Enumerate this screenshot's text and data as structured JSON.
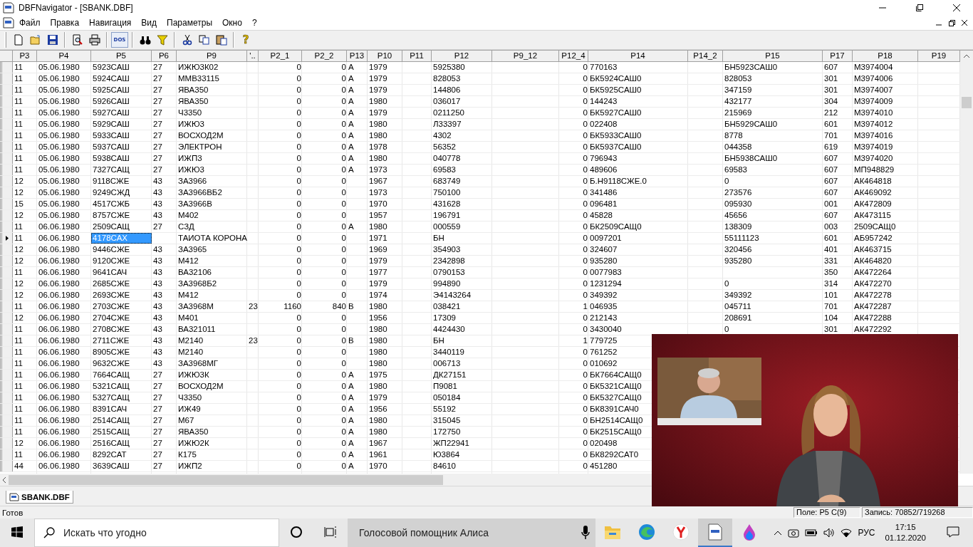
{
  "window": {
    "title": "DBFNavigator - [SBANK.DBF]"
  },
  "menu": [
    {
      "label": "Файл"
    },
    {
      "label": "Правка"
    },
    {
      "label": "Навигация"
    },
    {
      "label": "Вид"
    },
    {
      "label": "Параметры"
    },
    {
      "label": "Окно"
    },
    {
      "label": "?"
    }
  ],
  "toolbar": [
    {
      "kind": "new"
    },
    {
      "kind": "open"
    },
    {
      "kind": "save"
    },
    {
      "kind": "separator"
    },
    {
      "kind": "preview"
    },
    {
      "kind": "print"
    },
    {
      "kind": "separator"
    },
    {
      "kind": "dos",
      "label": "DOS"
    },
    {
      "kind": "separator"
    },
    {
      "kind": "find"
    },
    {
      "kind": "filter"
    },
    {
      "kind": "separator"
    },
    {
      "kind": "cut"
    },
    {
      "kind": "copy"
    },
    {
      "kind": "paste"
    },
    {
      "kind": "separator"
    },
    {
      "kind": "help",
      "label": "?"
    }
  ],
  "table": {
    "columns": [
      {
        "label": "P3",
        "kind": "text"
      },
      {
        "label": "P4",
        "kind": "text"
      },
      {
        "label": "P5",
        "kind": "text"
      },
      {
        "label": "P6",
        "kind": "text"
      },
      {
        "label": "P9",
        "kind": "text"
      },
      {
        "label": "'..",
        "kind": "text"
      },
      {
        "label": "P2_1",
        "kind": "number"
      },
      {
        "label": "P2_2",
        "kind": "number"
      },
      {
        "label": "P13",
        "kind": "text"
      },
      {
        "label": "P10",
        "kind": "text"
      },
      {
        "label": "P11"
      },
      {
        "label": "P12",
        "kind": "text"
      },
      {
        "label": "P9_12"
      },
      {
        "label": "P12_4",
        "kind": "number"
      },
      {
        "label": "P14",
        "kind": "text"
      },
      {
        "label": "P14_2"
      },
      {
        "label": "P15",
        "kind": "text"
      },
      {
        "label": "P17",
        "kind": "text"
      },
      {
        "label": "P18",
        "kind": "text"
      },
      {
        "label": "P19"
      }
    ],
    "rows": [
      {
        "selected": false,
        "cells": [
          "11",
          "05.06.1980",
          "5923САШ",
          "27",
          "ИЖЮ3К02",
          null,
          "0",
          "0",
          "А",
          "1979",
          null,
          "5925380",
          null,
          "0",
          "770163",
          null,
          "БН5923САШ0",
          "607",
          "М3974004",
          null
        ]
      },
      {
        "selected": false,
        "cells": [
          "11",
          "05.06.1980",
          "5924САШ",
          "27",
          "ММВ33115",
          null,
          "0",
          "0",
          "А",
          "1979",
          null,
          "828053",
          null,
          "0",
          "БК5924САШ0",
          null,
          "828053",
          "301",
          "М3974006",
          null
        ]
      },
      {
        "selected": false,
        "cells": [
          "11",
          "05.06.1980",
          "5925САШ",
          "27",
          "ЯВА350",
          null,
          "0",
          "0",
          "А",
          "1979",
          null,
          "144806",
          null,
          "0",
          "БК5925САШ0",
          null,
          "347159",
          "301",
          "М3974007",
          null
        ]
      },
      {
        "selected": false,
        "cells": [
          "11",
          "05.06.1980",
          "5926САШ",
          "27",
          "ЯВА350",
          null,
          "0",
          "0",
          "А",
          "1980",
          null,
          "036017",
          null,
          "0",
          "144243",
          null,
          "432177",
          "304",
          "М3974009",
          null
        ]
      },
      {
        "selected": false,
        "cells": [
          "11",
          "05.06.1980",
          "5927САШ",
          "27",
          "Ч3350",
          null,
          "0",
          "0",
          "А",
          "1979",
          null,
          "0211250",
          null,
          "0",
          "БК5927САШ0",
          null,
          "215969",
          "212",
          "М3974010",
          null
        ]
      },
      {
        "selected": false,
        "cells": [
          "11",
          "05.06.1980",
          "5929САШ",
          "27",
          "ИЖЮ3",
          null,
          "0",
          "0",
          "А",
          "1980",
          null,
          "Л33397",
          null,
          "0",
          "022408",
          null,
          "БН5929САШ0",
          "601",
          "М3974012",
          null
        ]
      },
      {
        "selected": false,
        "cells": [
          "11",
          "05.06.1980",
          "5933САШ",
          "27",
          "ВОСХОД2М",
          null,
          "0",
          "0",
          "А",
          "1980",
          null,
          "4302",
          null,
          "0",
          "БК5933САШ0",
          null,
          "8778",
          "701",
          "М3974016",
          null
        ]
      },
      {
        "selected": false,
        "cells": [
          "11",
          "05.06.1980",
          "5937САШ",
          "27",
          "ЭЛЕКТРОН",
          null,
          "0",
          "0",
          "А",
          "1978",
          null,
          "56352",
          null,
          "0",
          "БК5937САШ0",
          null,
          "044358",
          "619",
          "М3974019",
          null
        ]
      },
      {
        "selected": false,
        "cells": [
          "11",
          "05.06.1980",
          "5938САШ",
          "27",
          "ИЖП3",
          null,
          "0",
          "0",
          "А",
          "1980",
          null,
          "040778",
          null,
          "0",
          "796943",
          null,
          "БН5938САШ0",
          "607",
          "М3974020",
          null
        ]
      },
      {
        "selected": false,
        "cells": [
          "11",
          "05.06.1980",
          "7327САЩ",
          "27",
          "ИЖЮ3",
          null,
          "0",
          "0",
          "А",
          "1973",
          null,
          "69583",
          null,
          "0",
          "489606",
          null,
          "69583",
          "607",
          "МП948829",
          null
        ]
      },
      {
        "selected": false,
        "cells": [
          "12",
          "05.06.1980",
          "9118СЖЕ",
          "43",
          "ЗА3966",
          null,
          "0",
          "0",
          null,
          "1967",
          null,
          "683749",
          null,
          "0",
          "Б.Н9118СЖЕ.0",
          null,
          "0",
          "607",
          "АК464818",
          null
        ]
      },
      {
        "selected": false,
        "cells": [
          "12",
          "05.06.1980",
          "9249СЖД",
          "43",
          "ЗА3966ВБ2",
          null,
          "0",
          "0",
          null,
          "1973",
          null,
          "750100",
          null,
          "0",
          "341486",
          null,
          "273576",
          "607",
          "АК469092",
          null
        ]
      },
      {
        "selected": false,
        "cells": [
          "15",
          "05.06.1980",
          "4517СЖБ",
          "43",
          "ЗА3966В",
          null,
          "0",
          "0",
          null,
          "1970",
          null,
          "431628",
          null,
          "0",
          "096481",
          null,
          "095930",
          "001",
          "АК472809",
          null
        ]
      },
      {
        "selected": false,
        "cells": [
          "12",
          "05.06.1980",
          "8757СЖЕ",
          "43",
          "М402",
          null,
          "0",
          "0",
          null,
          "1957",
          null,
          "196791",
          null,
          "0",
          "45828",
          null,
          "45656",
          "607",
          "АК473115",
          null
        ]
      },
      {
        "selected": false,
        "cells": [
          "11",
          "06.06.1980",
          "2509САЩ",
          "27",
          "СЗД",
          null,
          "0",
          "0",
          "А",
          "1980",
          null,
          "000559",
          null,
          "0",
          "БК2509САЩ0",
          null,
          "138309",
          "003",
          "2509САЩ0",
          null
        ]
      },
      {
        "selected": true,
        "cells": [
          "11",
          "06.06.1980",
          {
            "text": "4178САХ",
            "selected": true
          },
          null,
          "ТАИОТА КОРОНА",
          null,
          "0",
          "0",
          null,
          "1971",
          null,
          "БН",
          null,
          "0",
          "0097201",
          null,
          "55111123",
          "601",
          "АБ957242",
          null
        ]
      },
      {
        "selected": false,
        "cells": [
          "12",
          "06.06.1980",
          "9446СЖЕ",
          "43",
          "ЗА3965",
          null,
          "0",
          "0",
          null,
          "1969",
          null,
          "354903",
          null,
          "0",
          "324607",
          null,
          "320456",
          "401",
          "АК463715",
          null
        ]
      },
      {
        "selected": false,
        "cells": [
          "12",
          "06.06.1980",
          "9120СЖЕ",
          "43",
          "М412",
          null,
          "0",
          "0",
          null,
          "1979",
          null,
          "2342898",
          null,
          "0",
          "935280",
          null,
          "935280",
          "331",
          "АК464820",
          null
        ]
      },
      {
        "selected": false,
        "cells": [
          "11",
          "06.06.1980",
          "9641САЧ",
          "43",
          "ВА32106",
          null,
          "0",
          "0",
          null,
          "1977",
          null,
          "0790153",
          null,
          "0",
          "0077983",
          null,
          null,
          "350",
          "АК472264",
          null
        ]
      },
      {
        "selected": false,
        "cells": [
          "12",
          "06.06.1980",
          "2685СЖЕ",
          "43",
          "ЗА3968Б2",
          null,
          "0",
          "0",
          null,
          "1979",
          null,
          "994890",
          null,
          "0",
          "1231294",
          null,
          "0",
          "314",
          "АК472270",
          null
        ]
      },
      {
        "selected": false,
        "cells": [
          "12",
          "06.06.1980",
          "2693СЖЕ",
          "43",
          "М412",
          null,
          "0",
          "0",
          null,
          "1974",
          null,
          "Э4143264",
          null,
          "0",
          "349392",
          null,
          "349392",
          "101",
          "АК472278",
          null
        ]
      },
      {
        "selected": false,
        "cells": [
          "11",
          "06.06.1980",
          "2703СЖЕ",
          "43",
          "ЗА3968М",
          "23",
          "1160",
          "840",
          "В",
          "1980",
          null,
          "038421",
          null,
          "1",
          "046935",
          null,
          "045711",
          "701",
          "АК472287",
          null
        ]
      },
      {
        "selected": false,
        "cells": [
          "12",
          "06.06.1980",
          "2704СЖЕ",
          "43",
          "М401",
          null,
          "0",
          "0",
          null,
          "1956",
          null,
          "17309",
          null,
          "0",
          "212143",
          null,
          "208691",
          "104",
          "АК472288",
          null
        ]
      },
      {
        "selected": false,
        "cells": [
          "11",
          "06.06.1980",
          "2708СЖЕ",
          "43",
          "ВА321011",
          null,
          "0",
          "0",
          null,
          "1980",
          null,
          "4424430",
          null,
          "0",
          "3430040",
          null,
          "0",
          "301",
          "АК472292",
          null
        ]
      },
      {
        "selected": false,
        "cells": [
          "11",
          "06.06.1980",
          "2711СЖЕ",
          "43",
          "М2140",
          "23",
          "0",
          "0",
          "В",
          "1980",
          null,
          "БН",
          null,
          "1",
          "779725",
          null,
          null,
          null,
          null,
          null
        ]
      },
      {
        "selected": false,
        "cells": [
          "11",
          "06.06.1980",
          "8905СЖЕ",
          "43",
          "М2140",
          null,
          "0",
          "0",
          null,
          "1980",
          null,
          "3440119",
          null,
          "0",
          "761252",
          null,
          null,
          null,
          null,
          null
        ]
      },
      {
        "selected": false,
        "cells": [
          "11",
          "06.06.1980",
          "9632СЖЕ",
          "43",
          "ЗА3968МГ",
          null,
          "0",
          "0",
          null,
          "1980",
          null,
          "006713",
          null,
          "0",
          "010692",
          null,
          null,
          null,
          null,
          null
        ]
      },
      {
        "selected": false,
        "cells": [
          "11",
          "06.06.1980",
          "7664САЩ",
          "27",
          "ИЖЮ3К",
          null,
          "0",
          "0",
          "А",
          "1975",
          null,
          "ДК27151",
          null,
          "0",
          "БК7664САЩ0",
          null,
          null,
          null,
          null,
          null
        ]
      },
      {
        "selected": false,
        "cells": [
          "11",
          "06.06.1980",
          "5321САЩ",
          "27",
          "ВОСХОД2М",
          null,
          "0",
          "0",
          "А",
          "1980",
          null,
          "П9081",
          null,
          "0",
          "БК5321САЩ0",
          null,
          null,
          null,
          null,
          null
        ]
      },
      {
        "selected": false,
        "cells": [
          "11",
          "06.06.1980",
          "5327САЩ",
          "27",
          "Ч3350",
          null,
          "0",
          "0",
          "А",
          "1979",
          null,
          "050184",
          null,
          "0",
          "БК5327САЩ0",
          null,
          null,
          null,
          null,
          null
        ]
      },
      {
        "selected": false,
        "cells": [
          "11",
          "06.06.1980",
          "8391САЧ",
          "27",
          "ИЖ49",
          null,
          "0",
          "0",
          "А",
          "1956",
          null,
          "55192",
          null,
          "0",
          "БК8391САЧ0",
          null,
          null,
          null,
          null,
          null
        ]
      },
      {
        "selected": false,
        "cells": [
          "11",
          "06.06.1980",
          "2514САЩ",
          "27",
          "М67",
          null,
          "0",
          "0",
          "А",
          "1980",
          null,
          "315045",
          null,
          "0",
          "БН2514САЩ0",
          null,
          null,
          null,
          null,
          null
        ]
      },
      {
        "selected": false,
        "cells": [
          "11",
          "06.06.1980",
          "2515САЩ",
          "27",
          "ЯВА350",
          null,
          "0",
          "0",
          "А",
          "1980",
          null,
          "172750",
          null,
          "0",
          "БК2515САЩ0",
          null,
          null,
          null,
          null,
          null
        ]
      },
      {
        "selected": false,
        "cells": [
          "12",
          "06.06.1980",
          "2516САЩ",
          "27",
          "ИЖЮ2К",
          null,
          "0",
          "0",
          "А",
          "1967",
          null,
          "ЖП22941",
          null,
          "0",
          "020498",
          null,
          null,
          null,
          null,
          null
        ]
      },
      {
        "selected": false,
        "cells": [
          "11",
          "06.06.1980",
          "8292САТ",
          "27",
          "К175",
          null,
          "0",
          "0",
          "А",
          "1961",
          null,
          "Ю3864",
          null,
          "0",
          "БК8292САТ0",
          null,
          null,
          null,
          null,
          null
        ]
      },
      {
        "selected": false,
        "cells": [
          "44",
          "06.06.1980",
          "3639САШ",
          "27",
          "ИЖП2",
          null,
          "0",
          "0",
          "А",
          "1970",
          null,
          "84610",
          null,
          "0",
          "451280",
          null,
          null,
          null,
          null,
          null
        ]
      }
    ]
  },
  "document_tabs": [
    {
      "label": "SBANK.DBF",
      "selected": true
    }
  ],
  "status_bar": {
    "text": "Готов",
    "field": "Поле: P5 C(9)",
    "record": "Запись: 70852/719268"
  },
  "taskbar": {
    "search": {
      "placeholder": "Искать что угодно"
    },
    "assistant": {
      "placeholder": "Голосовой помощник Алиса"
    },
    "apps": [
      {
        "kind": "folder",
        "selected": false
      },
      {
        "kind": "browser",
        "selected": false
      },
      {
        "kind": "yandex",
        "selected": false
      },
      {
        "kind": "dbf",
        "selected": true
      },
      {
        "kind": "paint",
        "selected": false
      }
    ],
    "language": "РУС",
    "time": "17:15",
    "date": "01.12.2020"
  }
}
